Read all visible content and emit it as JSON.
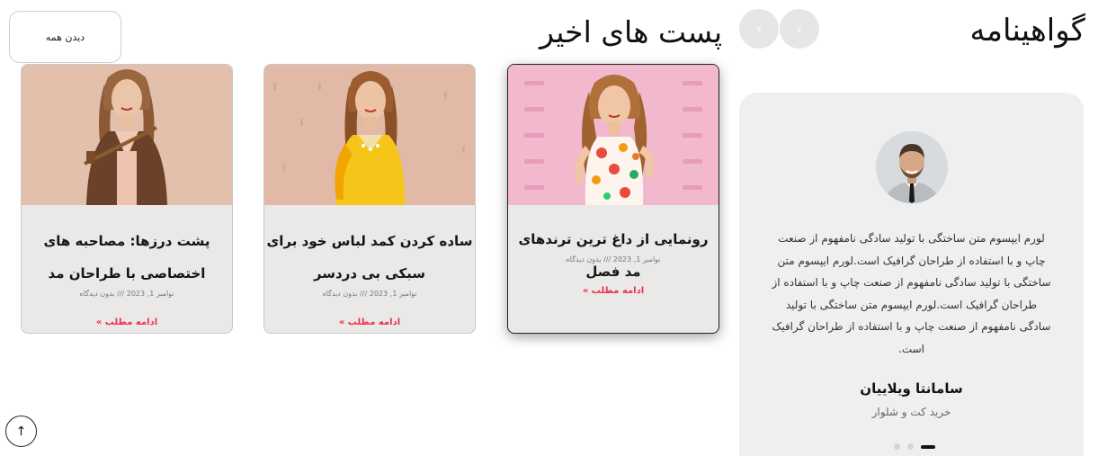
{
  "testimonials": {
    "title": "گواهینامه",
    "prev_icon": "chevron-left-icon",
    "next_icon": "chevron-right-icon",
    "prev_glyph": "‹",
    "next_glyph": "›",
    "text": "لورم ایپسوم متن ساختگی با تولید سادگی نامفهوم از صنعت چاپ و با استفاده از طراحان گرافیک است.لورم ایپسوم متن ساختگی با تولید سادگی نامفهوم از صنعت چاپ و با استفاده از طراحان گرافیک است.لورم ایپسوم متن ساختگی با تولید سادگی نامفهوم از صنعت چاپ و با استفاده از طراحان گرافیک است.",
    "name": "سامانتا ویلاییان",
    "role": "خرید کت و شلوار",
    "dots_total": 3,
    "dots_active": 3
  },
  "posts": {
    "title": "پست های اخیر",
    "see_all": "دیدن همه",
    "items": [
      {
        "title": "رونمایی از داغ ترین ترندهای مد فصل",
        "meta": "نوامبر 1, 2023 /// بدون دیدگاه",
        "more": "ادامه مطلب »"
      },
      {
        "title": "ساده کردن کمد لباس خود برای سبکی بی دردسر",
        "meta": "نوامبر 1, 2023 /// بدون دیدگاه",
        "more": "ادامه مطلب »"
      },
      {
        "title": "پشت درزها: مصاحبه های اختصاصی با طراحان مد",
        "meta": "نوامبر 1, 2023 /// بدون دیدگاه",
        "more": "ادامه مطلب »"
      }
    ]
  },
  "scroll_top": {
    "glyph": "↑",
    "icon": "arrow-up-icon"
  },
  "colors": {
    "accent": "#e8334e",
    "card_bg": "#ebe9e8",
    "testimonial_bg": "#efefef",
    "nav_btn": "#e6e6e6"
  }
}
